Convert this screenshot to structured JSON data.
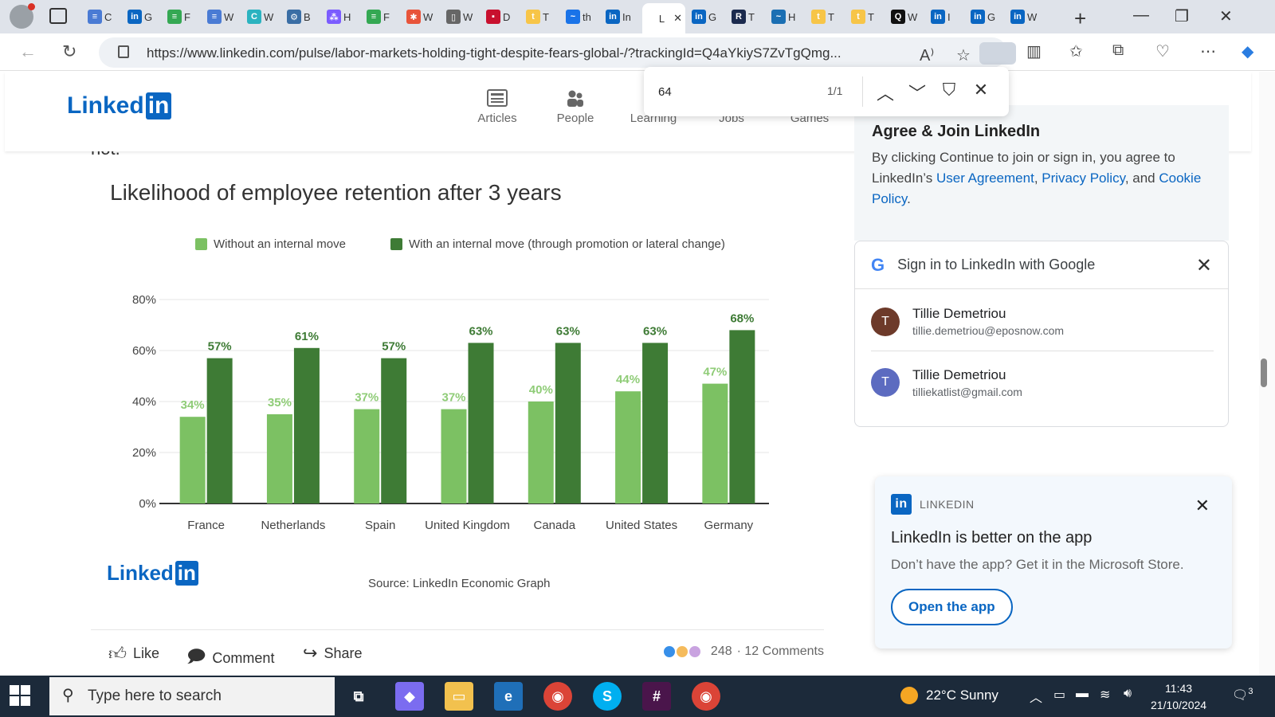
{
  "browser": {
    "tabs": [
      {
        "label": "C",
        "fav_color": "#4a7bd4",
        "fav_char": "≡"
      },
      {
        "label": "G",
        "fav_color": "#0a66c2",
        "fav_char": "in"
      },
      {
        "label": "F",
        "fav_color": "#34a853",
        "fav_char": "≡"
      },
      {
        "label": "W",
        "fav_color": "#4a7bd4",
        "fav_char": "≡"
      },
      {
        "label": "W",
        "fav_color": "#2bb3c0",
        "fav_char": "C"
      },
      {
        "label": "B",
        "fav_color": "#3a6ea5",
        "fav_char": "⚙"
      },
      {
        "label": "H",
        "fav_color": "#7b5cff",
        "fav_char": "⁂"
      },
      {
        "label": "F",
        "fav_color": "#34a853",
        "fav_char": "≡"
      },
      {
        "label": "W",
        "fav_color": "#e8543a",
        "fav_char": "✱"
      },
      {
        "label": "W",
        "fav_color": "#666666",
        "fav_char": "▯"
      },
      {
        "label": "D",
        "fav_color": "#c8102e",
        "fav_char": "▪"
      },
      {
        "label": "T",
        "fav_color": "#f7c548",
        "fav_char": "t"
      },
      {
        "label": "th",
        "fav_color": "#1a73e8",
        "fav_char": "~"
      },
      {
        "label": "In",
        "fav_color": "#0a66c2",
        "fav_char": "in"
      },
      {
        "label": "L",
        "fav_color": "#ffffff",
        "fav_char": ""
      },
      {
        "label": "G",
        "fav_color": "#0a66c2",
        "fav_char": "in"
      },
      {
        "label": "T",
        "fav_color": "#1b2a4e",
        "fav_char": "R"
      },
      {
        "label": "H",
        "fav_color": "#1b6fb3",
        "fav_char": "~"
      },
      {
        "label": "T",
        "fav_color": "#f7c548",
        "fav_char": "t"
      },
      {
        "label": "T",
        "fav_color": "#f7c548",
        "fav_char": "t"
      },
      {
        "label": "W",
        "fav_color": "#111111",
        "fav_char": "Q"
      },
      {
        "label": "I",
        "fav_color": "#0a66c2",
        "fav_char": "in"
      },
      {
        "label": "G",
        "fav_color": "#0a66c2",
        "fav_char": "in"
      },
      {
        "label": "W",
        "fav_color": "#0a66c2",
        "fav_char": "in"
      }
    ],
    "url": "https://www.linkedin.com/pulse/labor-markets-holding-tight-despite-fears-global-/?trackingId=Q4aYkiyS7ZvTgQmg..."
  },
  "find": {
    "query": "64",
    "count": "1/1"
  },
  "header": {
    "logo_text": "Linked",
    "logo_in": "in",
    "nav": [
      {
        "label": "Articles"
      },
      {
        "label": "People"
      },
      {
        "label": "Learning"
      },
      {
        "label": "Jobs"
      },
      {
        "label": "Games"
      }
    ]
  },
  "article": {
    "tail_text": "not."
  },
  "chart_data": {
    "type": "bar",
    "title": "Likelihood of employee retention after 3 years",
    "categories": [
      "France",
      "Netherlands",
      "Spain",
      "United Kingdom",
      "Canada",
      "United States",
      "Germany"
    ],
    "series": [
      {
        "name": "Without an internal move",
        "color": "#7cc163",
        "label_color": "#8fcc77",
        "values": [
          34,
          35,
          37,
          37,
          40,
          44,
          47
        ]
      },
      {
        "name": "With an internal move (through promotion or lateral change)",
        "color": "#3e7b35",
        "label_color": "#3e7b35",
        "values": [
          57,
          61,
          57,
          63,
          63,
          63,
          68
        ]
      }
    ],
    "ylim": [
      0,
      80
    ],
    "yticks": [
      "0%",
      "20%",
      "40%",
      "60%",
      "80%"
    ],
    "xlabel": "",
    "ylabel": "",
    "grid": true,
    "legend": "top",
    "source": "Source: LinkedIn Economic Graph",
    "logo_text": "Linked",
    "logo_in": "in"
  },
  "actions": {
    "like": "Like",
    "comment": "Comment",
    "share": "Share",
    "reaction_count": "248",
    "comments": "· 12 Comments"
  },
  "join": {
    "title": "Agree & Join LinkedIn",
    "text_prefix": "By clicking Continue to join or sign in, you agree to LinkedIn’s ",
    "user_agreement": "User Agreement",
    "sep1": ", ",
    "privacy": "Privacy Policy",
    "sep2": ", and ",
    "cookie": "Cookie Policy",
    "end": "."
  },
  "google": {
    "title": "Sign in to LinkedIn with Google",
    "accounts": [
      {
        "initial": "T",
        "name": "Tillie Demetriou",
        "email": "tillie.demetriou@eposnow.com",
        "color": "#6d3a2a"
      },
      {
        "initial": "T",
        "name": "Tillie Demetriou",
        "email": "tilliekatlist@gmail.com",
        "color": "#5c6bc0"
      }
    ]
  },
  "promo": {
    "brand": "LINKEDIN",
    "title": "LinkedIn is better on the app",
    "text": "Don’t have the app? Get it in the Microsoft Store.",
    "button": "Open the app"
  },
  "taskbar": {
    "search_placeholder": "Type here to search",
    "weather": "22°C  Sunny",
    "time": "11:43",
    "date": "21/10/2024",
    "notifications": "3"
  }
}
